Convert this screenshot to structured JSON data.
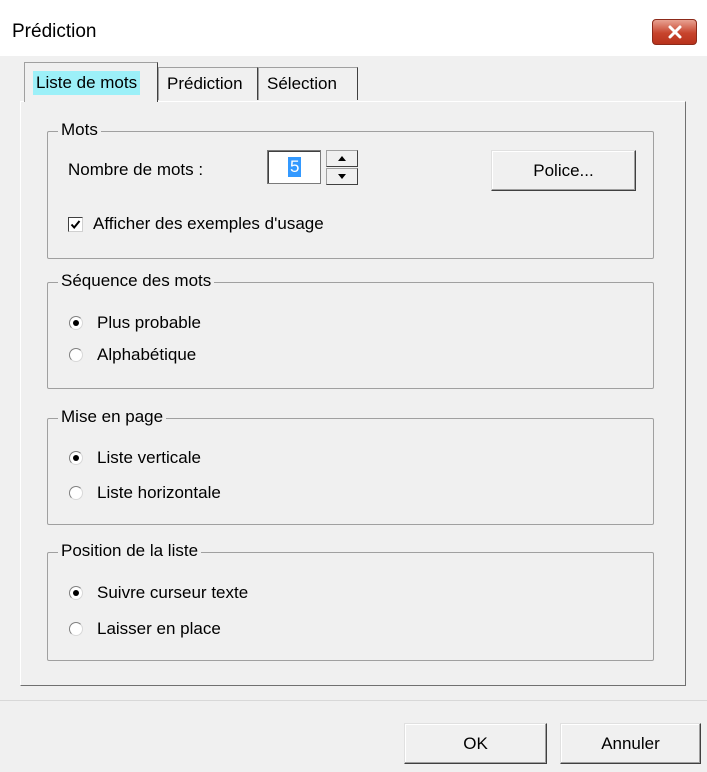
{
  "window": {
    "title": "Prédiction"
  },
  "tabs": [
    {
      "label": "Liste de mots",
      "active": true
    },
    {
      "label": "Prédiction",
      "active": false
    },
    {
      "label": "Sélection",
      "active": false
    }
  ],
  "mots": {
    "legend": "Mots",
    "count_label": "Nombre de mots :",
    "count_value": "5",
    "font_button": "Police...",
    "examples_label": "Afficher des exemples d'usage",
    "examples_checked": true
  },
  "sequence": {
    "legend": "Séquence des mots",
    "options": [
      "Plus probable",
      "Alphabétique"
    ],
    "selected": 0
  },
  "layout": {
    "legend": "Mise en page",
    "options": [
      "Liste verticale",
      "Liste horizontale"
    ],
    "selected": 0
  },
  "position": {
    "legend": "Position de la liste",
    "options": [
      "Suivre curseur texte",
      "Laisser en place"
    ],
    "selected": 0
  },
  "footer": {
    "ok_label": "OK",
    "cancel_label": "Annuler"
  }
}
